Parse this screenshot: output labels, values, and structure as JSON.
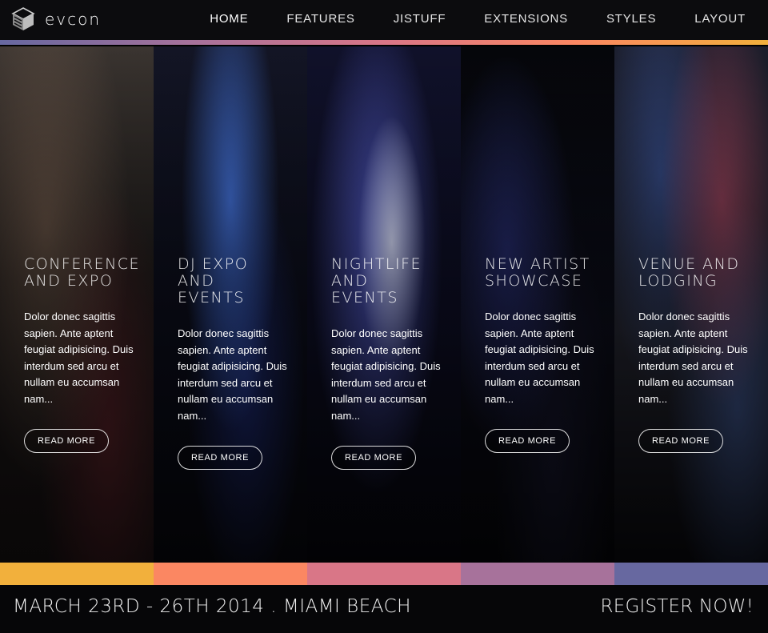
{
  "header": {
    "logo_text": "evcon",
    "nav": [
      {
        "label": "HOME"
      },
      {
        "label": "FEATURES"
      },
      {
        "label": "JISTUFF"
      },
      {
        "label": "EXTENSIONS"
      },
      {
        "label": "STYLES"
      },
      {
        "label": "LAYOUT"
      }
    ]
  },
  "colors": {
    "strip_gold": "#f2b03c",
    "strip_coral": "#fb8762",
    "strip_pink": "#d97687",
    "strip_mauve": "#a7729b",
    "strip_blue": "#6768a0",
    "header_bg": "#0c0c0e"
  },
  "panels": [
    {
      "title": "CONFERENCE AND EXPO",
      "text": "Dolor donec sagittis sapien. Ante aptent feugiat adipisicing. Duis interdum sed arcu et nullam eu accumsan nam...",
      "button": "READ MORE"
    },
    {
      "title": "DJ EXPO AND EVENTS",
      "text": "Dolor donec sagittis sapien. Ante aptent feugiat adipisicing. Duis interdum sed arcu et nullam eu accumsan nam...",
      "button": "READ MORE"
    },
    {
      "title": "NIGHTLIFE AND EVENTS",
      "text": "Dolor donec sagittis sapien. Ante aptent feugiat adipisicing. Duis interdum sed arcu et nullam eu accumsan nam...",
      "button": "READ MORE"
    },
    {
      "title": "NEW ARTIST SHOWCASE",
      "text": "Dolor donec sagittis sapien. Ante aptent feugiat adipisicing. Duis interdum sed arcu et nullam eu accumsan nam...",
      "button": "READ MORE"
    },
    {
      "title": "VENUE AND LODGING",
      "text": "Dolor donec sagittis sapien. Ante aptent feugiat adipisicing. Duis interdum sed arcu et nullam eu accumsan nam...",
      "button": "READ MORE"
    }
  ],
  "footer": {
    "date": "MARCH 23RD - 26TH 2014 . MIAMI BEACH",
    "register": "REGISTER NOW!"
  }
}
